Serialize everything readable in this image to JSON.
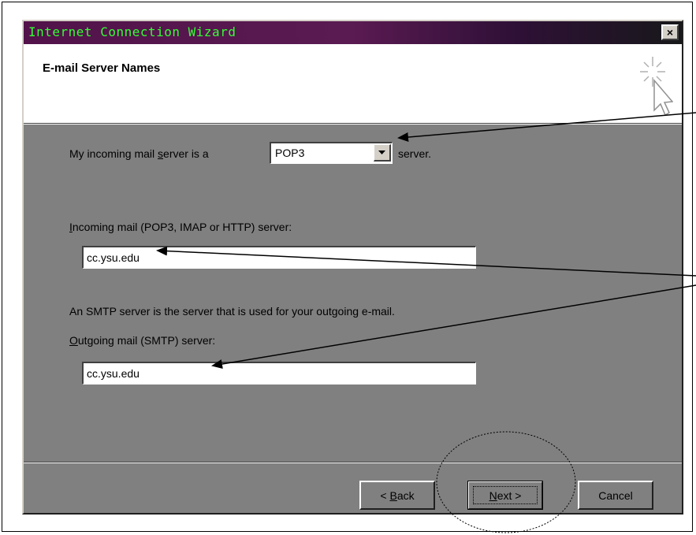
{
  "window": {
    "title": "Internet Connection Wizard",
    "close_glyph": "×"
  },
  "header": {
    "title": "E-mail Server Names",
    "icon": "wizard-sparkle-cursor-icon"
  },
  "server_type": {
    "label_before": "My incoming mail ",
    "label_accel": "s",
    "label_after": "erver is a",
    "selected": "POP3",
    "suffix": "server."
  },
  "incoming": {
    "label_accel": "I",
    "label_rest": "ncoming mail (POP3, IMAP or HTTP) server:",
    "value": "cc.ysu.edu"
  },
  "smtp_note": "An SMTP server is the server that is used for your outgoing e-mail.",
  "outgoing": {
    "label_accel": "O",
    "label_rest": "utgoing mail (SMTP) server:",
    "value": "cc.ysu.edu"
  },
  "buttons": {
    "back_prefix": "< ",
    "back_accel": "B",
    "back_rest": "ack",
    "next_accel": "N",
    "next_rest": "ext >",
    "cancel": "Cancel"
  },
  "colors": {
    "title_text": "#33ff33",
    "dialog_bg": "#808080",
    "header_bg": "#ffffff"
  }
}
